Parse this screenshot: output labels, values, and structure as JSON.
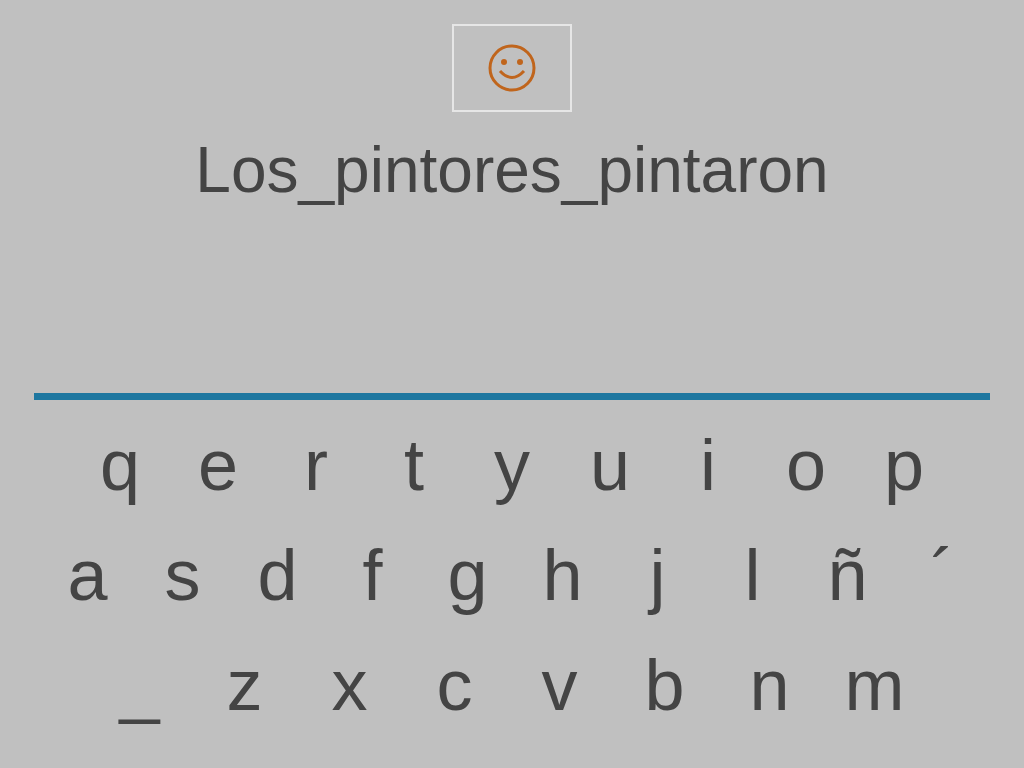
{
  "sentence": "Los_pintores_pintaron",
  "keyboard_rows": [
    [
      "q",
      "e",
      "r",
      "t",
      "y",
      "u",
      "i",
      "o",
      "p"
    ],
    [
      "a",
      "s",
      "d",
      "f",
      "g",
      "h",
      "j",
      "l",
      "ñ",
      "´"
    ],
    [
      "_",
      "z",
      "x",
      "c",
      "v",
      "b",
      "n",
      "m"
    ]
  ]
}
